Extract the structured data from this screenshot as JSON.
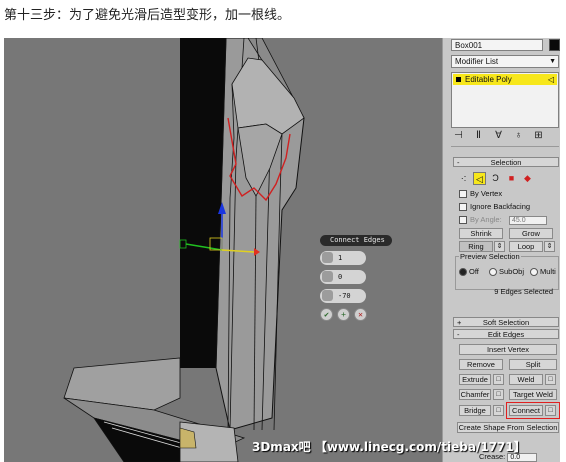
{
  "caption": "第十三步：为了避免光滑后造型变形，加一根线。",
  "watermark": "3Dmax吧 【www.linecg.com/tieba/1771】",
  "panel": {
    "object_name": "Box001",
    "object_color": "#0a0a0a",
    "modifier_list": "Modifier List",
    "stack_item": "Editable Poly",
    "selection": {
      "header": "Selection",
      "by_vertex": "By Vertex",
      "ignore_backfacing": "Ignore Backfacing",
      "by_angle": "By Angle:",
      "angle_value": "45.0",
      "shrink": "Shrink",
      "grow": "Grow",
      "ring": "Ring",
      "loop": "Loop",
      "preview_label": "Preview Selection",
      "off": "Off",
      "subobj": "SubObj",
      "multi": "Multi",
      "status": "9 Edges Selected"
    },
    "soft_selection": "Soft Selection",
    "edit_edges": {
      "header": "Edit Edges",
      "insert_vertex": "Insert Vertex",
      "remove": "Remove",
      "split": "Split",
      "extrude": "Extrude",
      "weld": "Weld",
      "chamfer": "Chamfer",
      "target_weld": "Target Weld",
      "bridge": "Bridge",
      "connect": "Connect",
      "create_shape": "Create Shape From Selection",
      "crease_label": "Crease:",
      "crease_value": "0.0"
    }
  },
  "caddy": {
    "title": "Connect Edges",
    "segments": "1",
    "pinch": "0",
    "slide": "-70"
  },
  "colors": {
    "highlight": "#e02020",
    "active_yellow": "#f7e71b"
  }
}
